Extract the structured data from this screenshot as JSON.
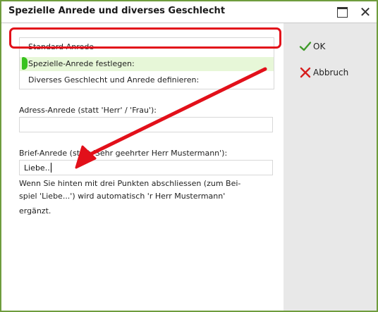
{
  "window": {
    "title": "Spezielle Anrede und diverses Geschlecht",
    "maximize_label": "",
    "close_label": "✕"
  },
  "options": [
    {
      "label": "Standard-Anrede",
      "selected": false
    },
    {
      "label": "Spezielle-Anrede festlegen:",
      "selected": true
    },
    {
      "label": "Diverses Geschlecht und Anrede definieren:",
      "selected": false
    }
  ],
  "adress": {
    "label": "Adress-Anrede (statt 'Herr' / 'Frau'):",
    "value": ""
  },
  "brief": {
    "label": "Brief-Anrede (statt 'Sehr geehrter Herr Mustermann'):",
    "value": "Liebe..."
  },
  "help": {
    "line1": "Wenn Sie hinten mit drei Punkten abschliessen (zum Bei-",
    "line2": "spiel 'Liebe...') wird automatisch 'r Herr Mustermann'",
    "line3": "ergänzt."
  },
  "actions": {
    "ok_label": "OK",
    "cancel_label": "Abbruch"
  },
  "colors": {
    "window_border": "#6f9c3d",
    "selected_row": "#e7f7d8",
    "marker_green": "#39c21f",
    "annotation_red": "#e2101a",
    "ok_green": "#3f9a2a",
    "cancel_red": "#d61e1e"
  },
  "icons": {
    "ok": "checkmark-icon",
    "cancel": "x-icon",
    "maximize": "maximize-icon",
    "close": "close-icon"
  }
}
